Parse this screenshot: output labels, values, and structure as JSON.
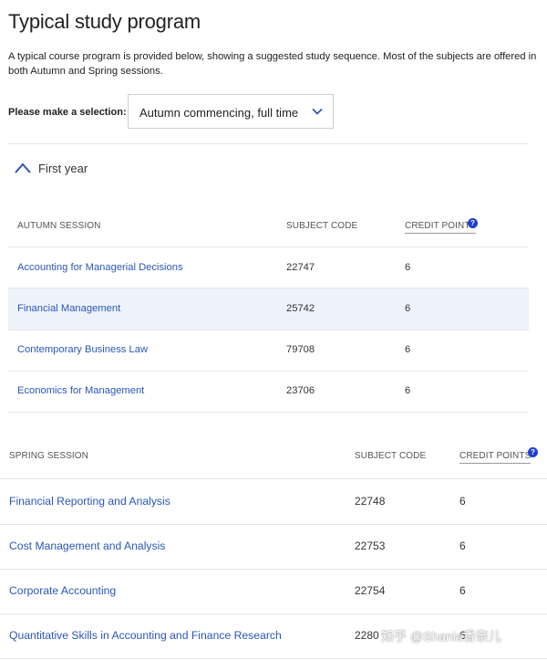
{
  "page": {
    "title": "Typical study program",
    "intro": "A typical course program is provided below, showing a suggested study sequence. Most of the subjects are offered in both Autumn and Spring sessions.",
    "selection_label": "Please make a selection:",
    "selection_value": "Autumn commencing, full time",
    "year_label": "First year"
  },
  "autumn": {
    "headers": {
      "session": "AUTUMN SESSION",
      "code": "SUBJECT CODE",
      "credit": "CREDIT POINTS"
    },
    "rows": [
      {
        "name": "Accounting for Managerial Decisions",
        "code": "22747",
        "credit": "6"
      },
      {
        "name": "Financial Management",
        "code": "25742",
        "credit": "6"
      },
      {
        "name": "Contemporary Business Law",
        "code": "79708",
        "credit": "6"
      },
      {
        "name": "Economics for Management",
        "code": "23706",
        "credit": "6"
      }
    ]
  },
  "spring": {
    "headers": {
      "session": "SPRING SESSION",
      "code": "SUBJECT CODE",
      "credit": "CREDIT POINTS"
    },
    "rows": [
      {
        "name": "Financial Reporting and Analysis",
        "code": "22748",
        "credit": "6"
      },
      {
        "name": "Cost Management and Analysis",
        "code": "22753",
        "credit": "6"
      },
      {
        "name": "Corporate Accounting",
        "code": "22754",
        "credit": "6"
      },
      {
        "name": "Quantitative Skills in Accounting and Finance Research",
        "code": "2280",
        "credit": "6"
      }
    ]
  },
  "watermark": "知乎 @Shania香奈儿",
  "icons": {
    "select": "chevron-down-icon",
    "year_toggle": "chevron-up-icon",
    "help": "question-mark-icon"
  },
  "colors": {
    "link": "#2a56b8",
    "help_icon": "#1f3fd1",
    "highlight_row": "#eef2fb"
  }
}
